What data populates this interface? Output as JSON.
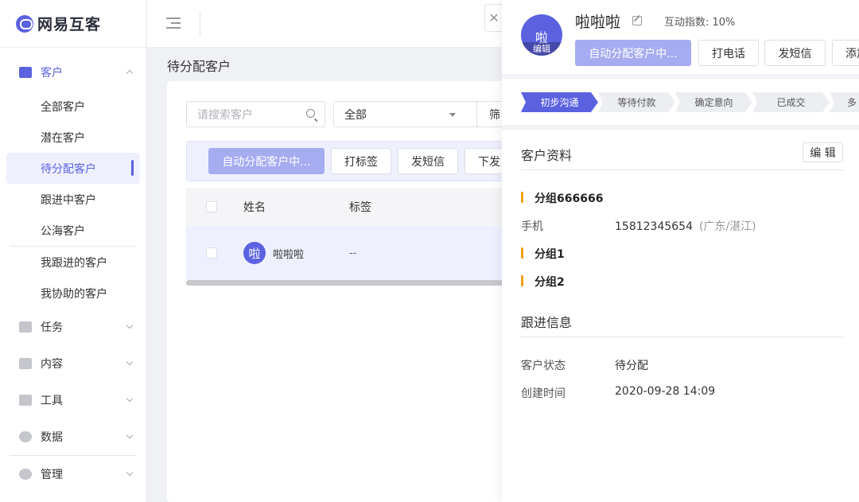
{
  "app": {
    "logo_text": "网易互客"
  },
  "sidebar": {
    "customer_group": "客户",
    "customer_items": [
      "全部客户",
      "潜在客户",
      "待分配客户",
      "跟进中客户",
      "公海客户"
    ],
    "my_items": [
      "我跟进的客户",
      "我协助的客户"
    ],
    "groups": [
      "任务",
      "内容",
      "工具",
      "数据",
      "管理"
    ]
  },
  "page": {
    "title": "待分配客户"
  },
  "filters": {
    "search_placeholder": "请搜索客户",
    "select_value": "全部",
    "filter_label": "筛"
  },
  "actions": {
    "auto_assign": "自动分配客户中...",
    "tag": "打标签",
    "sms": "发短信",
    "down": "下发"
  },
  "table": {
    "headers": {
      "name": "姓名",
      "tag": "标签"
    },
    "rows": [
      {
        "avatar": "啦",
        "name": "啦啦啦",
        "tag": "--"
      }
    ]
  },
  "close_label": "✕",
  "drawer": {
    "avatar_char": "啦",
    "avatar_edit": "编辑",
    "name": "啦啦啦",
    "index_text": "互动指数: 10%",
    "buttons": {
      "auto_assign": "自动分配客户中...",
      "call": "打电话",
      "sms": "发短信",
      "add": "添加"
    },
    "steps": [
      "初步沟通",
      "等待付款",
      "确定意向",
      "已成交",
      "多"
    ],
    "profile": {
      "title": "客户资料",
      "edit": "编 辑",
      "group1": "分组666666",
      "phone_label": "手机",
      "phone_value": "15812345654",
      "phone_note": "(广东/湛江)",
      "group2": "分组1",
      "group3": "分组2"
    },
    "followup": {
      "title": "跟进信息",
      "status_label": "客户状态",
      "status_value": "待分配",
      "created_label": "创建时间",
      "created_value": "2020-09-28 14:09"
    }
  },
  "colors": {
    "accent": "#5b62e0",
    "accent_dim": "#a6acf0",
    "group_marker": "#f0a01a"
  }
}
